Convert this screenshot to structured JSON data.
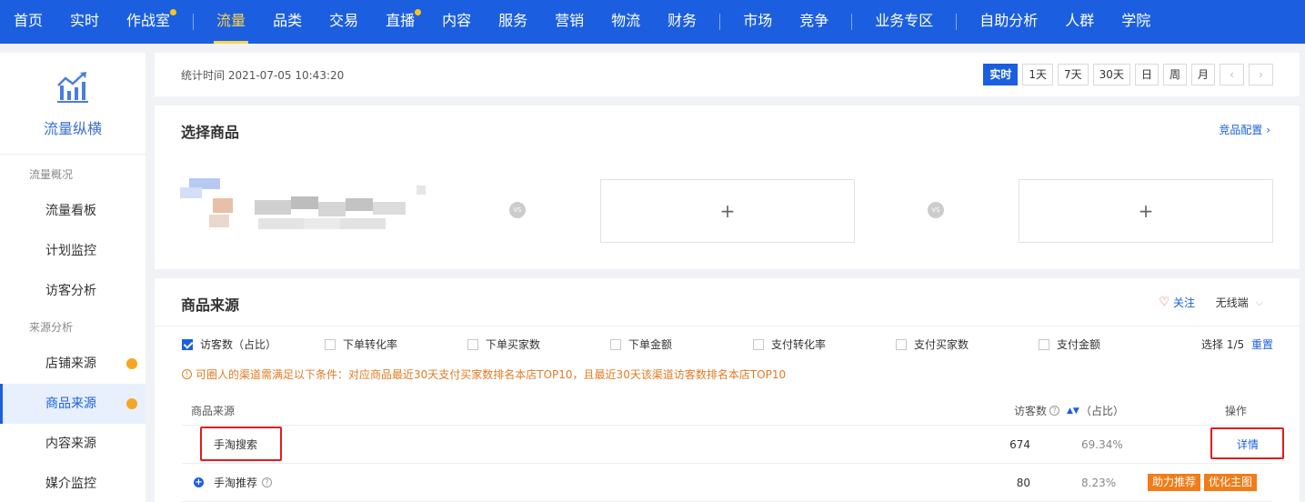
{
  "nav": {
    "items": [
      {
        "label": "首页",
        "dot": false
      },
      {
        "label": "实时",
        "dot": false
      },
      {
        "label": "作战室",
        "dot": true
      },
      {
        "sep": true
      },
      {
        "label": "流量",
        "dot": false,
        "active": true
      },
      {
        "label": "品类",
        "dot": false
      },
      {
        "label": "交易",
        "dot": false
      },
      {
        "label": "直播",
        "dot": true
      },
      {
        "label": "内容",
        "dot": false
      },
      {
        "label": "服务",
        "dot": false
      },
      {
        "label": "营销",
        "dot": false
      },
      {
        "label": "物流",
        "dot": false
      },
      {
        "label": "财务",
        "dot": false
      },
      {
        "sep": true
      },
      {
        "label": "市场",
        "dot": false
      },
      {
        "label": "竞争",
        "dot": false
      },
      {
        "sep": true
      },
      {
        "label": "业务专区",
        "dot": false
      },
      {
        "sep": true
      },
      {
        "label": "自助分析",
        "dot": false
      },
      {
        "label": "人群",
        "dot": false
      },
      {
        "label": "学院",
        "dot": false
      }
    ]
  },
  "sidebar": {
    "title": "流量纵横",
    "group1": "流量概况",
    "items1": [
      "流量看板",
      "计划监控",
      "访客分析"
    ],
    "group2": "来源分析",
    "items2": [
      {
        "label": "店铺来源",
        "dot": true,
        "active": false
      },
      {
        "label": "商品来源",
        "dot": true,
        "active": true
      },
      {
        "label": "内容来源",
        "dot": false,
        "active": false
      },
      {
        "label": "媒介监控",
        "dot": false,
        "active": false
      }
    ]
  },
  "timebar": {
    "stat_time": "统计时间 2021-07-05 10:43:20",
    "buttons": [
      "实时",
      "1天",
      "7天",
      "30天",
      "日",
      "周",
      "月"
    ],
    "active": "实时",
    "prev": "‹",
    "next": "›"
  },
  "select": {
    "title": "选择商品",
    "link": "竞品配置",
    "link_arrow": "›",
    "vs": "VS",
    "add": "+"
  },
  "source": {
    "title": "商品来源",
    "follow": "关注",
    "follow_icon": "♡",
    "platform": "无线端",
    "platform_chevron": "⌵",
    "checks": [
      {
        "label": "访客数（占比）",
        "checked": true
      },
      {
        "label": "下单转化率",
        "checked": false
      },
      {
        "label": "下单买家数",
        "checked": false
      },
      {
        "label": "下单金额",
        "checked": false
      },
      {
        "label": "支付转化率",
        "checked": false
      },
      {
        "label": "支付买家数",
        "checked": false
      },
      {
        "label": "支付金额",
        "checked": false
      }
    ],
    "select_count": "选择 1/5",
    "reset": "重置",
    "notice_icon": "!",
    "notice": "可圈人的渠道需满足以下条件：对应商品最近30天支付买家数排名本店TOP10，且最近30天该渠道访客数排名本店TOP10",
    "columns": {
      "source": "商品来源",
      "visitors": "访客数",
      "ratio": "（占比）",
      "ops": "操作"
    },
    "help_icon": "?",
    "sort_icon": "▲▼",
    "rows": [
      {
        "name": "手淘搜索",
        "visitors": "674",
        "ratio": "69.34%",
        "ops": [
          "详情"
        ]
      },
      {
        "name": "手淘推荐",
        "visitors": "80",
        "ratio": "8.23%",
        "ops": [
          "助力推荐",
          "优化主图"
        ],
        "expand_icon": "+"
      }
    ]
  },
  "colors": {
    "nav_bg": "#1b5fe0",
    "accent": "#1b5fe0",
    "nav_active": "#ffd34d",
    "orange": "#f07d19",
    "highlight_red": "#e21c1c"
  }
}
